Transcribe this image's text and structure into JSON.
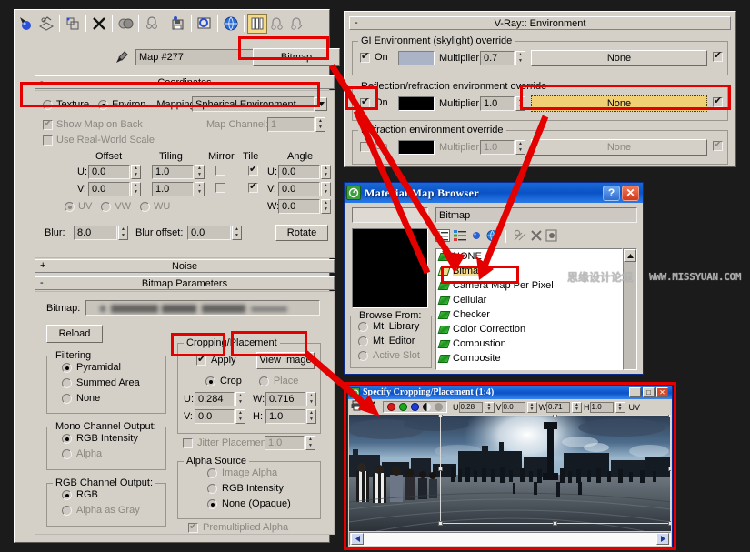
{
  "colors": {
    "panel": "#d4d0c8",
    "highlight_red": "#e50000",
    "accent_yellow": "#f5d98b",
    "title_blue": "#0a52c6",
    "background": "#1b1b1b"
  },
  "material_editor": {
    "toolbar_icons": [
      "get-material-icon",
      "put-to-scene-icon",
      "assign-to-selection-icon",
      "reset-map-icon",
      "make-material-copy-icon",
      "make-unique-icon",
      "put-to-library-icon",
      "material-id-channel-icon",
      "show-map-in-viewport-icon",
      "show-end-result-icon",
      "go-to-parent-icon",
      "go-forward-sibling-icon"
    ],
    "eyedropper_icon": "eyedropper-icon",
    "map_name": "Map #277",
    "map_type_button": "Bitmap",
    "coordinates": {
      "rollup_title": "Coordinates",
      "rollup_sign": "-",
      "texture_label": "Texture",
      "environ_label": "Environ",
      "mapping_label": "Mapping:",
      "mapping_value": "Spherical Environment",
      "show_map_on_back": "Show Map on Back",
      "map_channel_label": "Map Channel:",
      "map_channel_value": "1",
      "use_real_world_scale": "Use Real-World Scale",
      "col_offset": "Offset",
      "col_tiling": "Tiling",
      "col_mirror": "Mirror",
      "col_tile": "Tile",
      "col_angle": "Angle",
      "u_label": "U:",
      "v_label": "V:",
      "w_label": "W:",
      "offset_u": "0.0",
      "offset_v": "0.0",
      "tiling_u": "1.0",
      "tiling_v": "1.0",
      "angle_u": "0.0",
      "angle_v": "0.0",
      "angle_w": "0.0",
      "uv_label": "UV",
      "vw_label": "VW",
      "wu_label": "WU",
      "blur_label": "Blur:",
      "blur_value": "8.0",
      "blur_offset_label": "Blur offset:",
      "blur_offset_value": "0.0",
      "rotate_button": "Rotate"
    },
    "noise_rollup": {
      "title": "Noise",
      "sign": "+"
    },
    "bitmap_params": {
      "rollup_title": "Bitmap Parameters",
      "rollup_sign": "-",
      "bitmap_label": "Bitmap:",
      "bitmap_path": "",
      "reload_button": "Reload",
      "filtering_group": "Filtering",
      "filtering_options": [
        "Pyramidal",
        "Summed Area",
        "None"
      ],
      "mono_channel_group": "Mono Channel Output:",
      "mono_options": [
        "RGB Intensity",
        "Alpha"
      ],
      "rgb_channel_group": "RGB Channel Output:",
      "rgb_options": [
        "RGB",
        "Alpha as Gray"
      ],
      "cropping_group": "Cropping/Placement",
      "apply_label": "Apply",
      "view_image_button": "View Image",
      "crop_label": "Crop",
      "place_label": "Place",
      "u_label": "U:",
      "v_label": "V:",
      "w_label": "W:",
      "h_label": "H:",
      "u_value": "0.284",
      "v_value": "0.0",
      "w_value": "0.716",
      "h_value": "1.0",
      "jitter_label": "Jitter Placement:",
      "jitter_value": "1.0",
      "alpha_source_group": "Alpha Source",
      "alpha_options": [
        "Image Alpha",
        "RGB Intensity",
        "None (Opaque)"
      ],
      "premultiplied_label": "Premultiplied Alpha"
    }
  },
  "vray_environment": {
    "rollup_title": "V-Ray:: Environment",
    "rollup_sign": "-",
    "gi": {
      "group": "GI Environment (skylight) override",
      "on_label": "On",
      "multiplier_label": "Multiplier:",
      "multiplier_value": "0.7",
      "map_button": "None",
      "swatch_color": "#aab4c6"
    },
    "reflection": {
      "group": "Reflection/refraction environment override",
      "on_label": "On",
      "multiplier_label": "Multiplier:",
      "multiplier_value": "1.0",
      "map_button": "None",
      "swatch_color": "#000000"
    },
    "refraction": {
      "group": "Refraction environment override",
      "on_label": "On",
      "multiplier_label": "Multiplier:",
      "multiplier_value": "1.0",
      "map_button": "None",
      "swatch_color": "#000000"
    }
  },
  "material_map_browser": {
    "title": "Material/Map Browser",
    "app_icon": "max-logo-icon",
    "help_button": "?",
    "close_button": "✕",
    "search_value": "",
    "selected_name": "Bitmap",
    "toolbar_icons": [
      "view-list-icon",
      "view-small-icons-icon",
      "view-large-icons-icon",
      "view-text-icon",
      "update-scene-materials-icon",
      "delete-icon",
      "clear-icon"
    ],
    "browse_from_group": "Browse From:",
    "browse_from_options": [
      "Mtl Library",
      "Mtl Editor",
      "Active Slot"
    ],
    "map_list": [
      "NONE",
      "Bitmap",
      "Camera Map Per Pixel",
      "Cellular",
      "Checker",
      "Color Correction",
      "Combustion",
      "Composite"
    ],
    "selected_index": 1
  },
  "crop_window": {
    "title": "Specify Cropping/Placement  (1:4)",
    "app_icon": "max-logo-icon",
    "minimize_button": "_",
    "maximize_button": "□",
    "close_button": "✕",
    "print_icon": "print-icon",
    "cancel_icon": "cancel-icon",
    "channel_icons": [
      "red-channel-icon",
      "green-channel-icon",
      "blue-channel-icon",
      "alpha-channel-icon",
      "mono-channel-icon"
    ],
    "u_label": "U",
    "v_label": "V",
    "w_label": "W",
    "h_label": "H",
    "u_value": "0.28",
    "v_value": "0.0",
    "w_value": "0.71",
    "h_value": "1.0",
    "mode_label": "UV",
    "image_description": "panoramic HDRI of Trafalgar Square"
  },
  "watermark": {
    "chinese": "思缘设计论坛",
    "latin": "WWW.MISSYUAN.COM"
  }
}
